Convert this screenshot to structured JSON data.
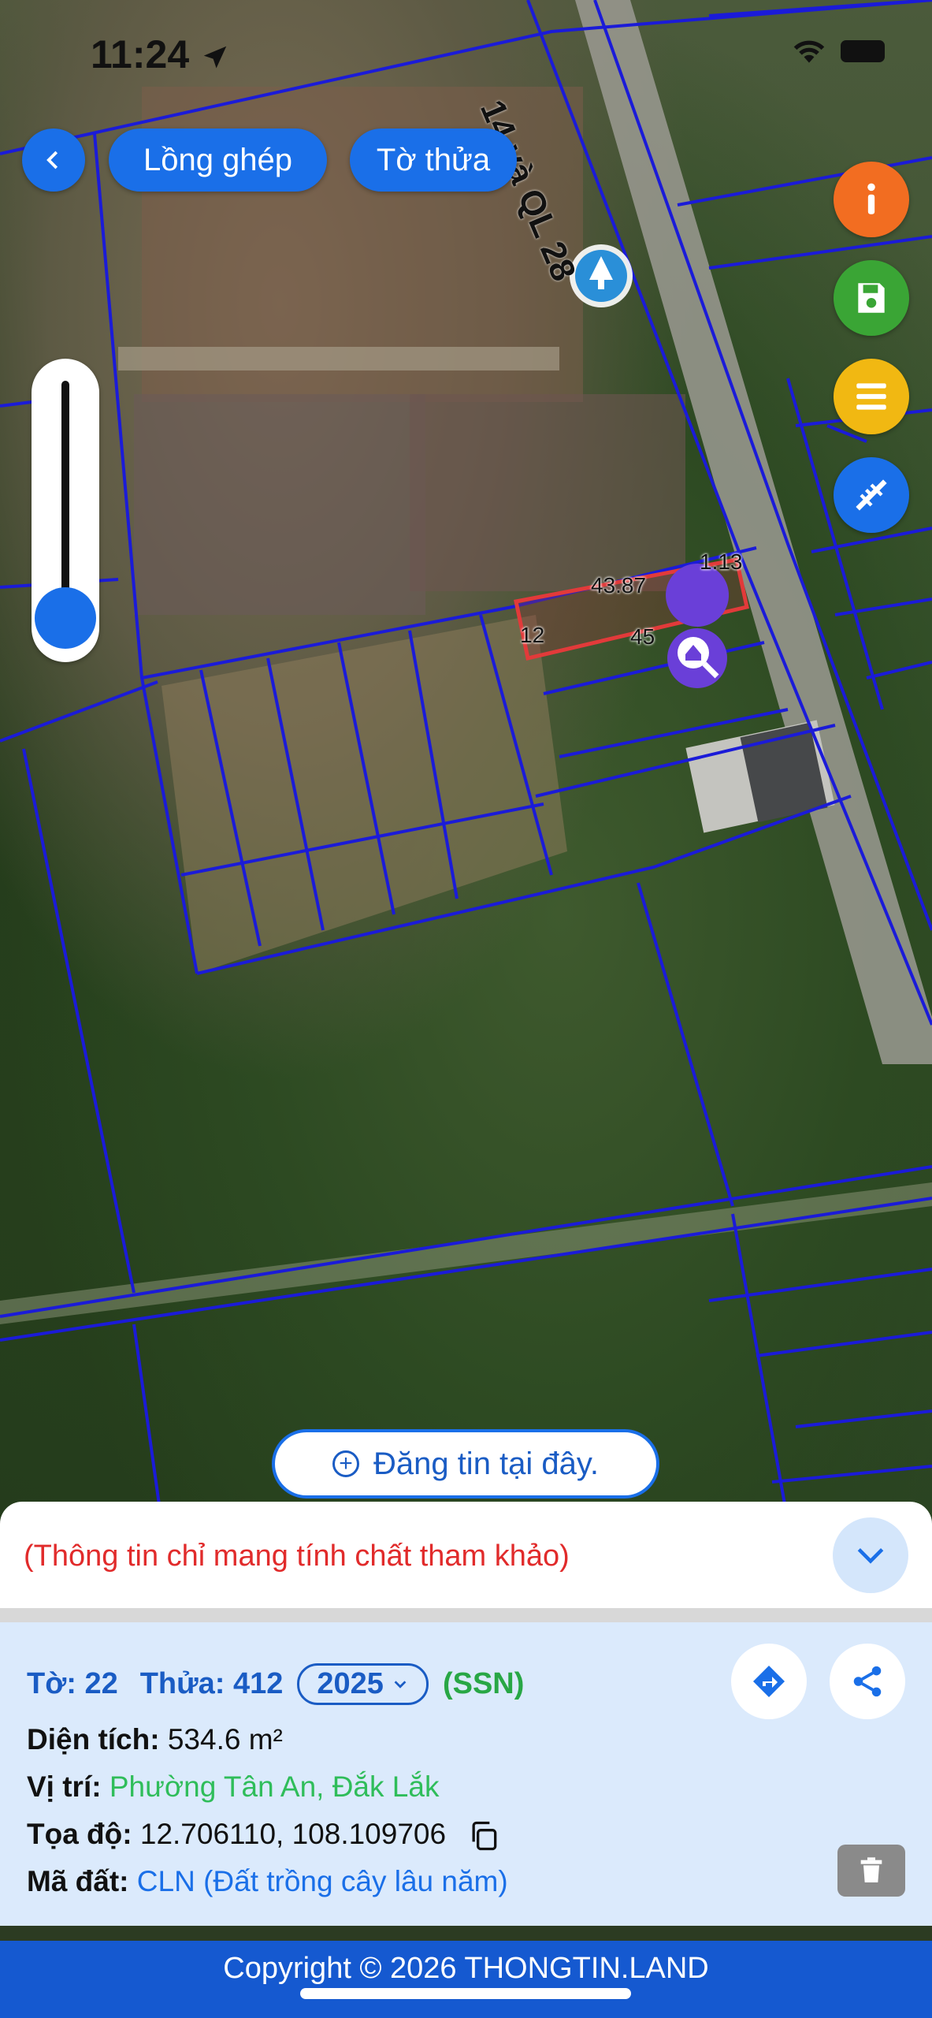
{
  "status": {
    "time": "11:24"
  },
  "map": {
    "road_label": "14 và QL 28",
    "parcel_dims": {
      "top": "43.87",
      "right": "1.13",
      "left": "12",
      "bottom": "45"
    }
  },
  "toolbar": {
    "longghep_label": "Lồng ghép",
    "tothua_label": "Tờ thửa"
  },
  "side_buttons": [
    "info",
    "save",
    "list",
    "edit-tool"
  ],
  "post_button": {
    "label": "Đăng tin tại đây."
  },
  "notice": {
    "text": "(Thông tin chỉ mang tính chất tham khảo)"
  },
  "parcel": {
    "to_label": "Tờ: 22",
    "thua_label": "Thửa: 412",
    "year": "2025",
    "code": "(SSN)",
    "dien_tich_label": "Diện tích:",
    "dien_tich_value": "534.6 m²",
    "vi_tri_label": "Vị trí:",
    "vi_tri_value": "Phường Tân An, Đắk Lắk",
    "toa_do_label": "Tọa độ:",
    "toa_do_value": "12.706110, 108.109706",
    "ma_dat_label": "Mã đất:",
    "ma_dat_value": "CLN (Đất trồng cây lâu năm)"
  },
  "footer": {
    "copyright": "Copyright © 2026 THONGTIN.LAND"
  },
  "colors": {
    "primary": "#1a6fe8",
    "info": "#f26d21",
    "save": "#3aa535",
    "list": "#f1b812",
    "notice": "#e12b2b"
  }
}
